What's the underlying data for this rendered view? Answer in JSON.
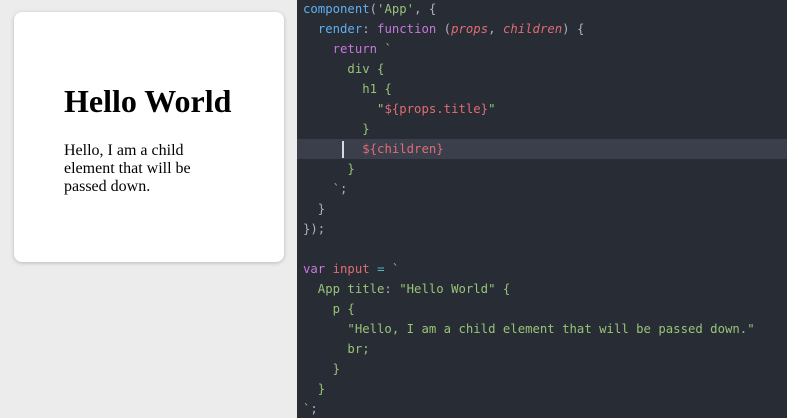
{
  "preview": {
    "heading": "Hello World",
    "paragraph": "Hello, I am a child element that will be passed down."
  },
  "editor": {
    "active_line": 8,
    "lines": [
      [
        [
          "t-fn",
          "component"
        ],
        [
          "t-punc",
          "("
        ],
        [
          "t-str",
          "'App'"
        ],
        [
          "t-punc",
          ", {"
        ]
      ],
      [
        [
          "t-punc",
          "  "
        ],
        [
          "t-fn",
          "render"
        ],
        [
          "t-punc",
          ": "
        ],
        [
          "t-kw",
          "function"
        ],
        [
          "t-punc",
          " ("
        ],
        [
          "t-param",
          "props"
        ],
        [
          "t-punc",
          ", "
        ],
        [
          "t-param",
          "children"
        ],
        [
          "t-punc",
          ") {"
        ]
      ],
      [
        [
          "t-punc",
          "    "
        ],
        [
          "t-kw",
          "return"
        ],
        [
          "t-punc",
          " "
        ],
        [
          "t-str",
          "`"
        ]
      ],
      [
        [
          "t-str",
          "      div {"
        ]
      ],
      [
        [
          "t-str",
          "        h1 {"
        ]
      ],
      [
        [
          "t-str",
          "          \""
        ],
        [
          "t-prop",
          "${props.title}"
        ],
        [
          "t-str",
          "\""
        ]
      ],
      [
        [
          "t-str",
          "        }"
        ]
      ],
      [
        [
          "t-str",
          "        "
        ],
        [
          "t-prop",
          "${children}"
        ]
      ],
      [
        [
          "t-str",
          "      }"
        ]
      ],
      [
        [
          "t-punc",
          "    "
        ],
        [
          "t-str",
          "`"
        ],
        [
          "t-punc",
          ";"
        ]
      ],
      [
        [
          "t-punc",
          "  }"
        ]
      ],
      [
        [
          "t-punc",
          "});"
        ]
      ],
      [],
      [
        [
          "t-kw",
          "var"
        ],
        [
          "t-punc",
          " "
        ],
        [
          "t-prop",
          "input"
        ],
        [
          "t-punc",
          " "
        ],
        [
          "t-op",
          "="
        ],
        [
          "t-punc",
          " "
        ],
        [
          "t-str",
          "`"
        ]
      ],
      [
        [
          "t-str",
          "  App title: \"Hello World\" {"
        ]
      ],
      [
        [
          "t-str",
          "    p {"
        ]
      ],
      [
        [
          "t-str",
          "      \"Hello, I am a child element that will be passed down.\""
        ]
      ],
      [
        [
          "t-str",
          "      br;"
        ]
      ],
      [
        [
          "t-str",
          "    }"
        ]
      ],
      [
        [
          "t-str",
          "  }"
        ]
      ],
      [
        [
          "t-str",
          "`"
        ],
        [
          "t-punc",
          ";"
        ]
      ]
    ]
  }
}
